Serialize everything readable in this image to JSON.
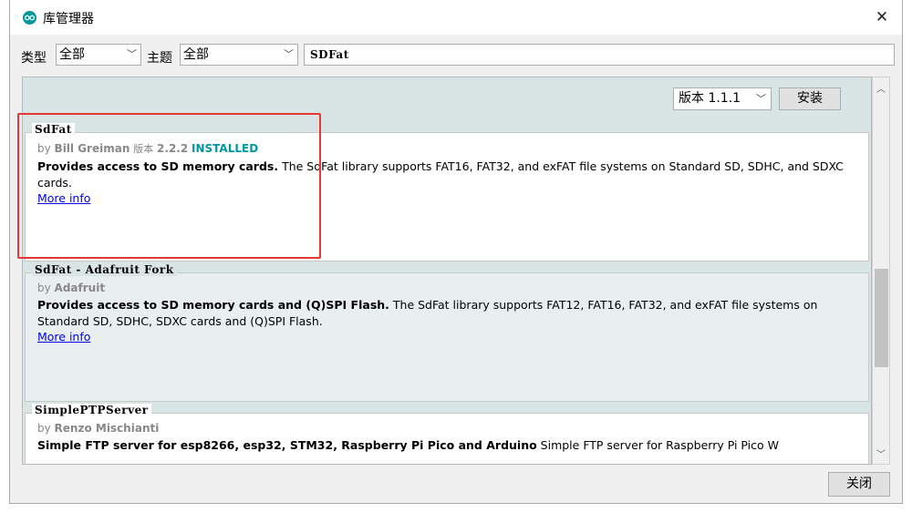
{
  "window": {
    "title": "库管理器",
    "close_glyph": "✕"
  },
  "filters": {
    "type_label": "类型",
    "type_value": "全部",
    "topic_label": "主题",
    "topic_value": "全部",
    "search_value": "SDFat"
  },
  "controls": {
    "version_value": "版本 1.1.1",
    "install_label": "安装",
    "close_label": "关闭"
  },
  "libraries": [
    {
      "name": "SdFat",
      "by_prefix": "by",
      "author": "Bill Greiman",
      "version_label": "版本",
      "version": "2.2.2",
      "status": "INSTALLED",
      "desc_bold": "Provides access to SD memory cards.",
      "desc_rest": " The SdFat library supports FAT16, FAT32, and exFAT file systems on Standard SD, SDHC, and SDXC cards.",
      "more": "More info"
    },
    {
      "name": "SdFat - Adafruit Fork",
      "by_prefix": "by",
      "author": "Adafruit",
      "desc_bold": "Provides access to SD memory cards and (Q)SPI Flash.",
      "desc_rest": " The SdFat library supports FAT12, FAT16, FAT32, and exFAT file systems on Standard SD, SDHC, SDXC cards and (Q)SPI Flash.",
      "more": "More info"
    },
    {
      "name": "SimplePTPServer",
      "by_prefix": "by",
      "author": "Renzo Mischianti",
      "desc_bold": "Simple FTP server for esp8266, esp32, STM32, Raspberry Pi Pico and Arduino",
      "desc_rest": " Simple FTP server for Raspberry Pi Pico W"
    }
  ],
  "colors": {
    "accent": "#00979d",
    "highlight_box": "#e53935",
    "link": "#0000ee"
  }
}
